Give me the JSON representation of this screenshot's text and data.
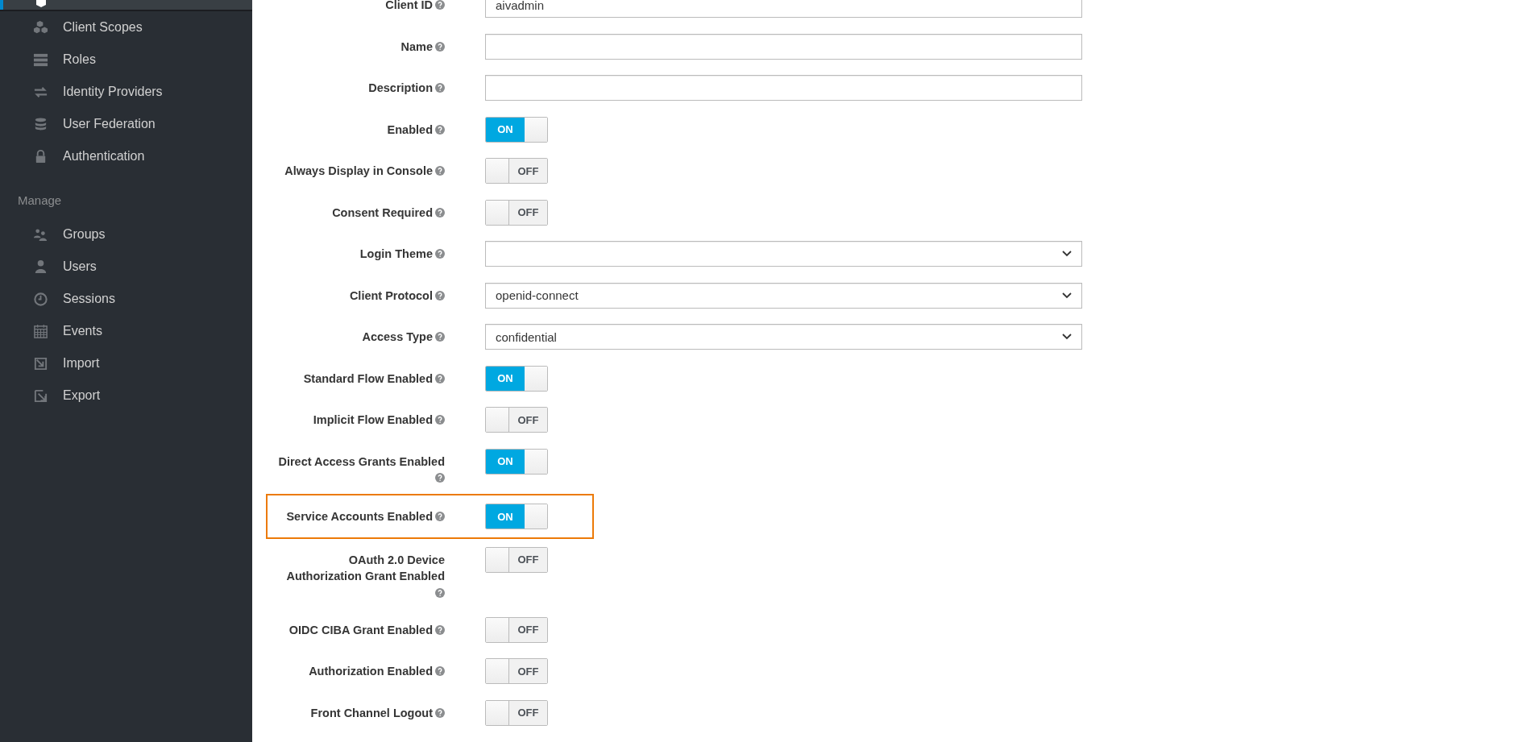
{
  "sidebar": {
    "items": [
      {
        "selected": true
      },
      {
        "label": "Client Scopes",
        "selected": false
      },
      {
        "label": "Roles",
        "selected": false
      },
      {
        "label": "Identity Providers",
        "selected": false
      },
      {
        "label": "User Federation",
        "selected": false
      },
      {
        "label": "Authentication",
        "selected": false
      }
    ],
    "section": "Manage",
    "manage_items": [
      {
        "label": "Groups",
        "selected": false
      },
      {
        "label": "Users",
        "selected": false
      },
      {
        "label": "Sessions",
        "selected": false
      },
      {
        "label": "Events",
        "selected": false
      },
      {
        "label": "Import",
        "selected": false
      },
      {
        "label": "Export",
        "selected": false
      }
    ]
  },
  "form": {
    "rows": [
      {
        "label": "Client ID",
        "kind": "text",
        "value": "aivadmin",
        "highlighted": false
      },
      {
        "label": "Name",
        "kind": "text",
        "highlighted": false
      },
      {
        "label": "Description",
        "kind": "text",
        "highlighted": false
      },
      {
        "label": "Enabled",
        "kind": "toggle",
        "on": true,
        "text": "ON",
        "highlighted": false
      },
      {
        "label": "Always Display in Console",
        "kind": "toggle",
        "on": false,
        "text": "OFF",
        "highlighted": false
      },
      {
        "label": "Consent Required",
        "kind": "toggle",
        "on": false,
        "text": "OFF",
        "highlighted": false
      },
      {
        "label": "Login Theme",
        "kind": "select",
        "highlighted": false
      },
      {
        "label": "Client Protocol",
        "kind": "select",
        "value": "openid-connect",
        "highlighted": false
      },
      {
        "label": "Access Type",
        "kind": "select",
        "value": "confidential",
        "highlighted": false
      },
      {
        "label": "Standard Flow Enabled",
        "kind": "toggle",
        "on": true,
        "text": "ON",
        "highlighted": false
      },
      {
        "label": "Implicit Flow Enabled",
        "kind": "toggle",
        "on": false,
        "text": "OFF",
        "highlighted": false
      },
      {
        "label": "Direct Access Grants Enabled",
        "kind": "toggle",
        "on": true,
        "text": "ON",
        "highlighted": false
      },
      {
        "label": "Service Accounts Enabled",
        "kind": "toggle",
        "on": true,
        "text": "ON",
        "highlighted": true
      },
      {
        "label": "OAuth 2.0 Device Authorization Grant Enabled",
        "kind": "toggle",
        "on": false,
        "text": "OFF",
        "highlighted": false
      },
      {
        "label": "OIDC CIBA Grant Enabled",
        "kind": "toggle",
        "on": false,
        "text": "OFF",
        "highlighted": false
      },
      {
        "label": "Authorization Enabled",
        "kind": "toggle",
        "on": false,
        "text": "OFF",
        "highlighted": false
      },
      {
        "label": "Front Channel Logout",
        "kind": "toggle",
        "on": false,
        "text": "OFF",
        "highlighted": false
      }
    ]
  }
}
